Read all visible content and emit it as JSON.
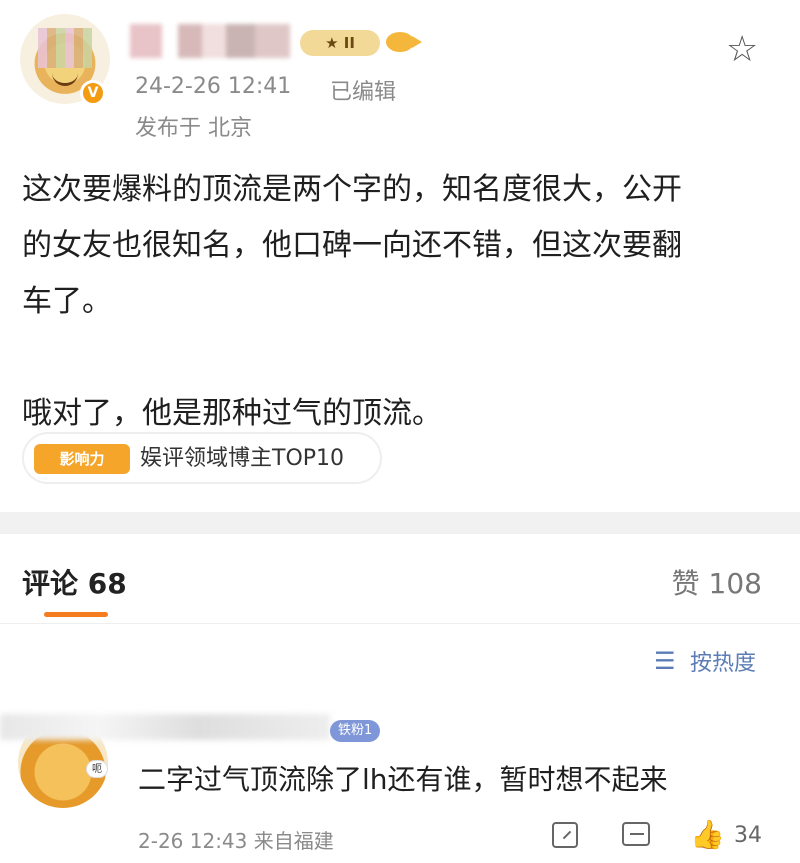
{
  "post": {
    "author_name": "",
    "level_badge": "★ II",
    "verified_badge": "V",
    "timestamp": "24-2-26 12:41",
    "edited": "已编辑",
    "location": "发布于 北京",
    "content_lines": [
      "这次要爆料的顶流是两个字的，知名度很大，公开",
      "的女友也很知名，他口碑一向还不错，但这次要翻",
      "车了。",
      "哦对了，他是那种过气的顶流。"
    ],
    "tag": {
      "badge": "影响力",
      "label": "娱评领域博主TOP10"
    }
  },
  "comments_header": {
    "comments_tab": "评论 68",
    "likes_tab": "赞 108"
  },
  "sort": {
    "icon": "☰",
    "label": "按热度"
  },
  "comment": {
    "author_name": "",
    "fan_badge": "铁粉1",
    "avatar_badge": "呃",
    "text": "二字过气顶流除了lh还有谁，暂时想不起来",
    "time": "2-26 12:43 来自福建",
    "likes": "34"
  },
  "icons": {
    "star": "star-icon",
    "share": "share-icon",
    "comment": "comment-icon",
    "like": "thumbs-up-icon"
  },
  "colors": {
    "accent": "#f57c1f",
    "link": "#5b7cb5",
    "badge_gold": "#f4a52a",
    "fan_badge": "#7f97d8"
  }
}
